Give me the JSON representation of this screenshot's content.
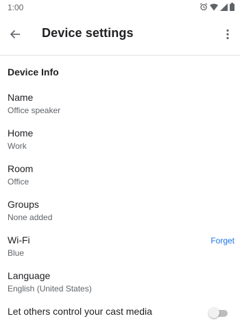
{
  "status_bar": {
    "time": "1:00",
    "icons": [
      "alarm-icon",
      "wifi-icon",
      "signal-icon",
      "battery-icon"
    ]
  },
  "app_bar": {
    "back_icon": "arrow-back-icon",
    "title": "Device settings",
    "menu_icon": "more-vert-icon"
  },
  "section": {
    "header": "Device Info"
  },
  "settings": [
    {
      "title": "Name",
      "subtitle": "Office speaker"
    },
    {
      "title": "Home",
      "subtitle": "Work"
    },
    {
      "title": "Room",
      "subtitle": "Office"
    },
    {
      "title": "Groups",
      "subtitle": "None added"
    },
    {
      "title": "Wi-Fi",
      "subtitle": "Blue",
      "action": "Forget"
    },
    {
      "title": "Language",
      "subtitle": "English (United States)"
    },
    {
      "title": "Let others control your cast media",
      "toggle": false
    }
  ],
  "colors": {
    "accent": "#1a73e8",
    "primary_text": "#202124",
    "secondary_text": "#5f6368",
    "divider": "#e0e0e0",
    "toggle_track_off": "#bdbdbd"
  }
}
